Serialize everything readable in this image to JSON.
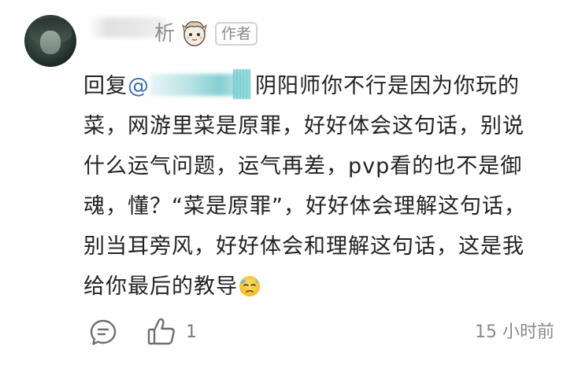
{
  "comment": {
    "author_badge": "作者",
    "author_name_visible_tail": "析",
    "reply_prefix": "回复",
    "mention_at": "@",
    "lines": [
      "阴阳师你不行是因为你玩的",
      "菜，网游里菜是原罪，好好体会这句话，别说",
      "什么运气问题，运气再差，pvp看的也不是御",
      "魂，懂？“菜是原罪”，好好体会理解这句话，",
      "别当耳旁风，好好体会和理解这句话，这是我",
      "给你最后的教导"
    ],
    "trailing_emoji": "sweat-disappointed-face-emoji",
    "like_count": "1",
    "timestamp": "15 小时前"
  },
  "icons": {
    "comment": "comment-bubble-icon",
    "like": "thumbs-up-icon",
    "flair": "anime-character-flair-icon"
  },
  "colors": {
    "text": "#222222",
    "mention": "#3d6fb8",
    "muted": "#8a8a8a",
    "badge_border": "#d2d2d2"
  }
}
